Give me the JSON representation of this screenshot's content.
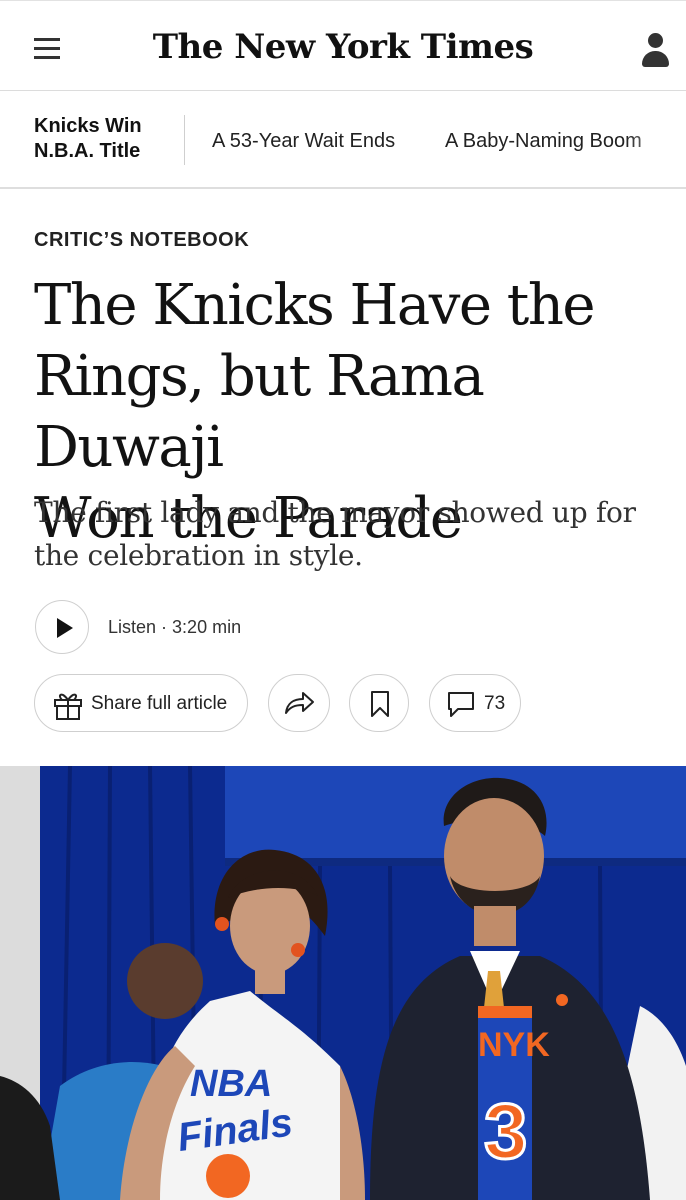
{
  "header": {
    "logo_text": "The New York Times",
    "menu_icon": "hamburger-menu-icon",
    "account_icon": "user-account-icon"
  },
  "subnav": {
    "primary": [
      "Knicks Win",
      "N.B.A. Title"
    ],
    "links": [
      "A 53-Year Wait Ends",
      "A Baby-Naming Boom"
    ]
  },
  "article": {
    "kicker": "CRITIC’S NOTEBOOK",
    "headline": [
      "The Knicks Have the",
      "Rings, but Rama Duwaji",
      "Won the Parade"
    ],
    "summary": [
      "The first lady and the mayor showed up for",
      "the celebration in style."
    ],
    "listen": {
      "label": "Listen",
      "duration": "3:20 min",
      "icon": "play-icon"
    },
    "actions": {
      "share_full_label": "Share full article",
      "share_full_icon": "gift-icon",
      "share_icon": "share-arrow-icon",
      "save_icon": "bookmark-icon",
      "comments_icon": "comment-bubble-icon",
      "comments_count": "73"
    }
  },
  "photo": {
    "jersey_text": "NYK",
    "jersey_number": "3",
    "shirt_text_top": "NBA",
    "shirt_text_bottom": "Finals"
  },
  "colors": {
    "text": "#121212",
    "divider": "#dcdcdc",
    "photo_backdrop": "#0c2a8f",
    "knicks_orange": "#f26722",
    "knicks_blue": "#1d47b8"
  }
}
